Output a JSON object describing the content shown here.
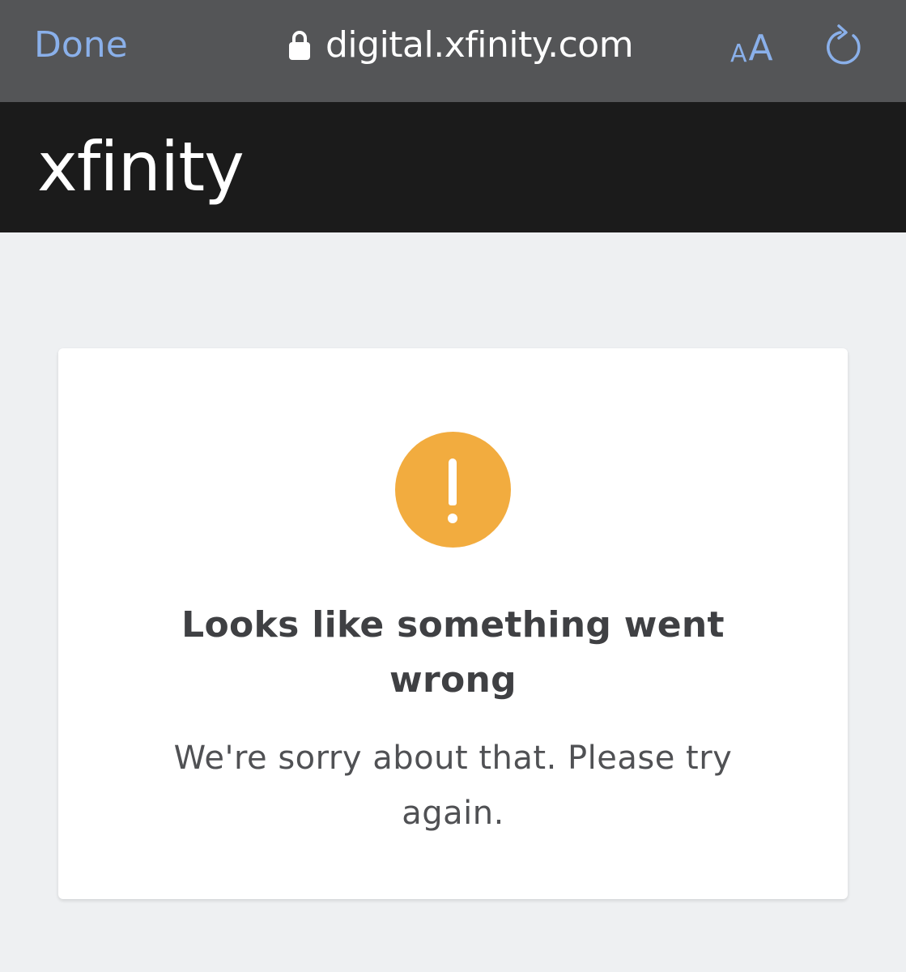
{
  "browser": {
    "done_label": "Done",
    "url": "digital.xfinity.com",
    "text_size_small": "A",
    "text_size_large": "A",
    "accent_color": "#8ab0ea",
    "toolbar_color": "#545557",
    "icons": {
      "lock": "lock-icon",
      "reload": "reload-icon"
    }
  },
  "header": {
    "logo_text": "xfinity",
    "background": "#1b1b1b"
  },
  "error": {
    "icon": "warning-icon",
    "icon_glyph": "!",
    "icon_color": "#f2ac3f",
    "title": "Looks like something went wrong",
    "message": "We're sorry about that. Please try again."
  }
}
